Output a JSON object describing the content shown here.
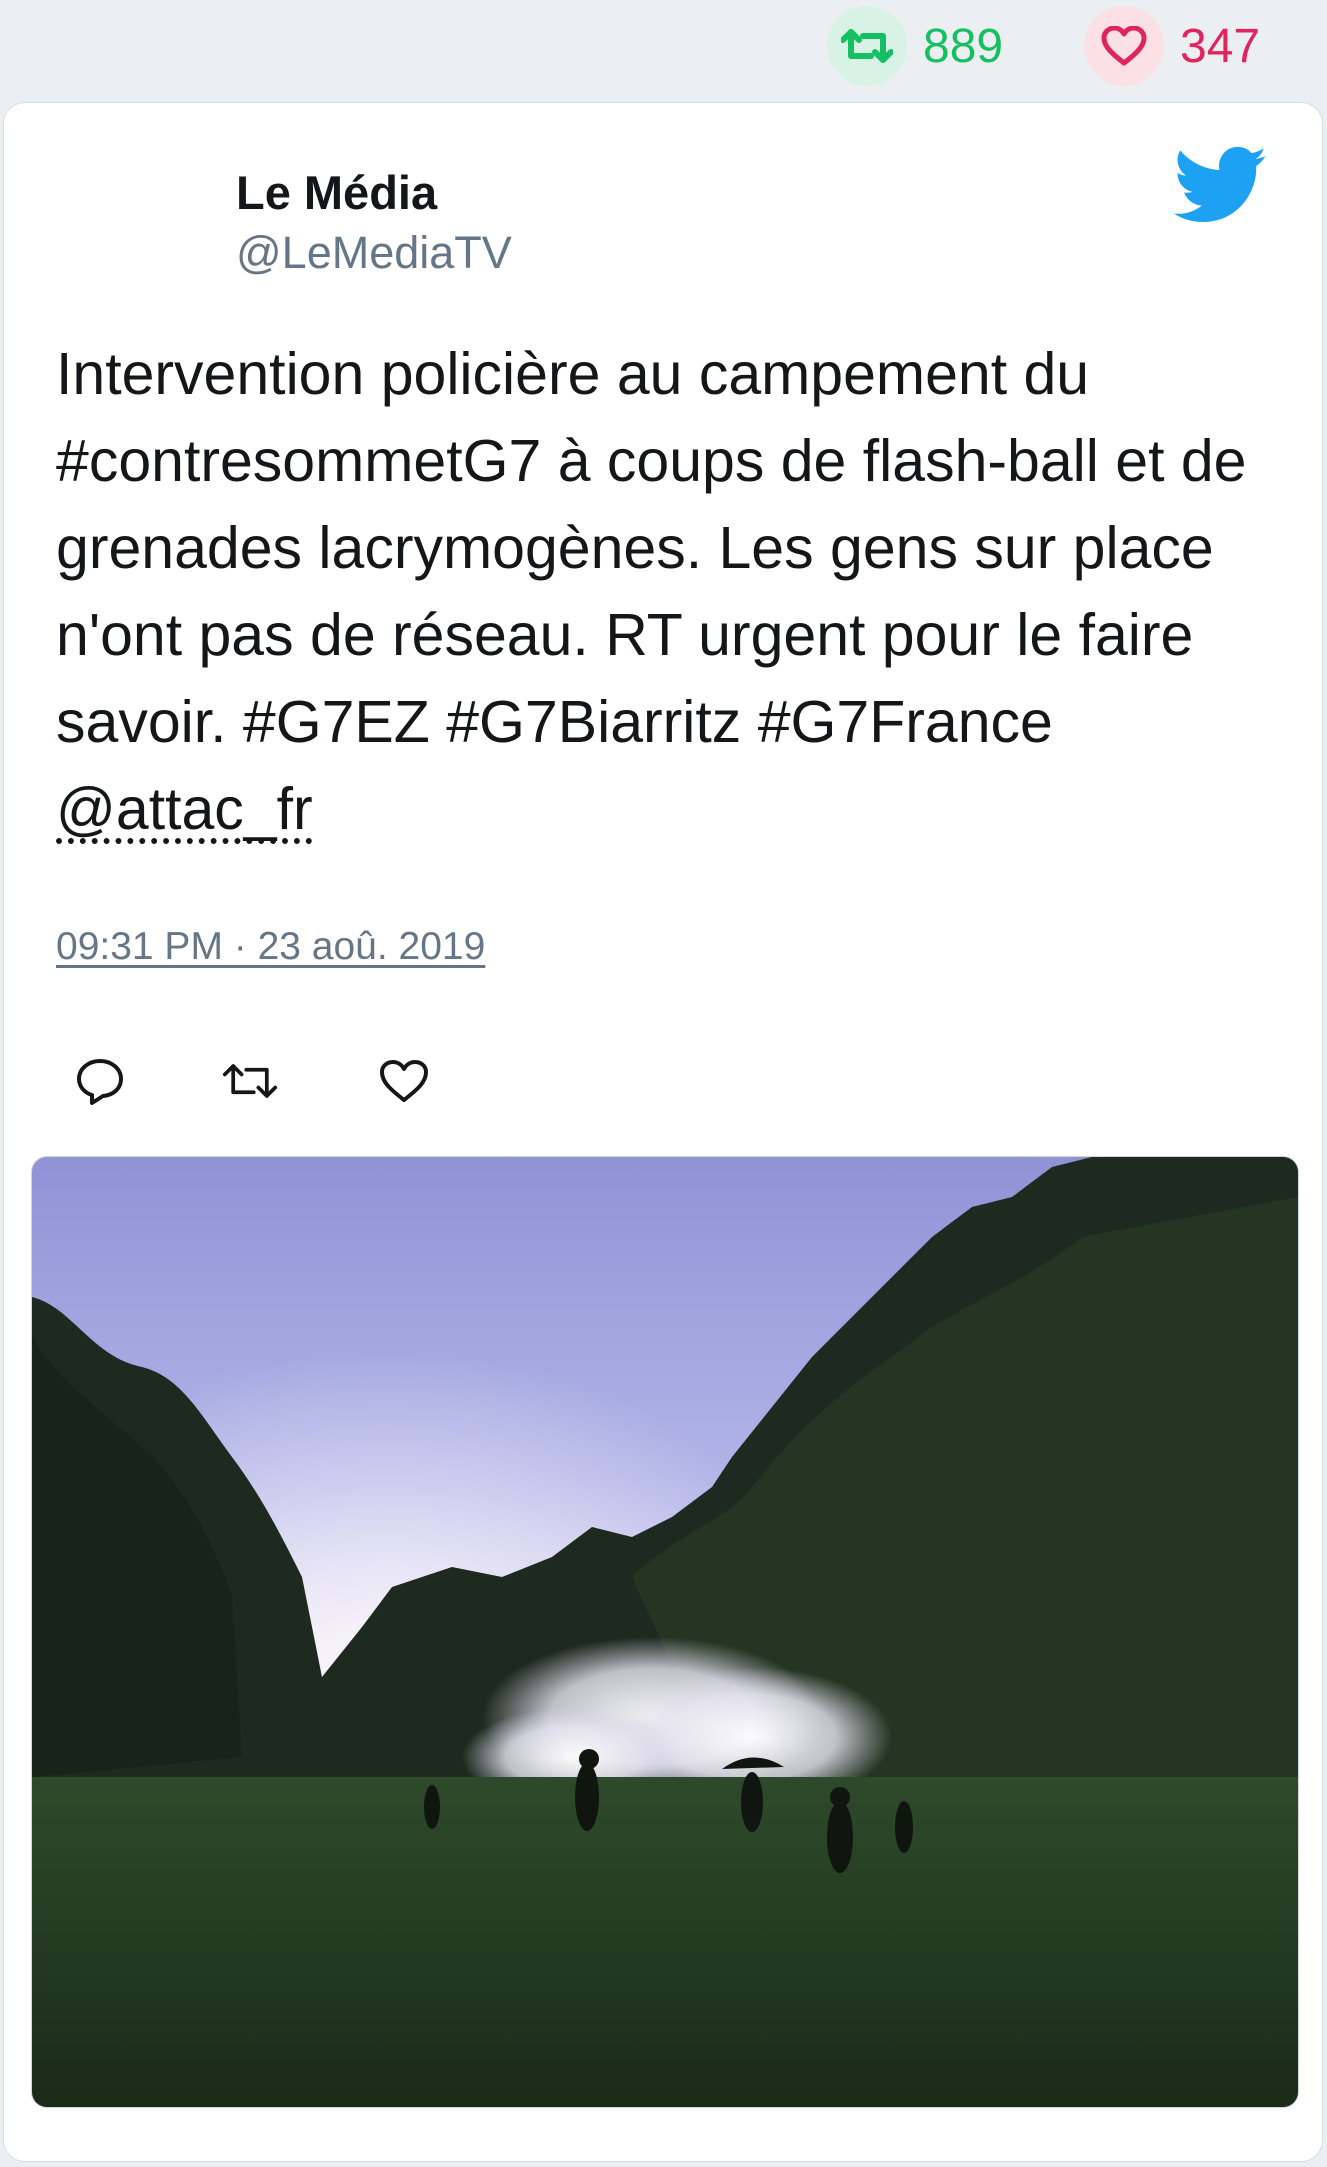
{
  "top_stats": {
    "retweet_icon": "retweet-icon",
    "retweet_count": "889",
    "like_icon": "heart-icon",
    "like_count": "347",
    "colors": {
      "retweet": "#17bf63",
      "like": "#e0245e"
    }
  },
  "tweet": {
    "author_name": "Le Média",
    "author_handle": "@LeMediaTV",
    "brand_icon": "twitter-bird-icon",
    "text_plain": "Intervention policière au campement du #contresommetG7 à coups de flash-ball et de grenades lacrymogènes. Les gens sur place n'ont pas de réseau. RT urgent pour le faire savoir. #G7EZ #G7Biarritz #G7France",
    "mention": "@attac_fr",
    "timestamp": "09:31 PM · 23 aoû. 2019",
    "actions": [
      {
        "name": "reply",
        "icon": "reply-icon"
      },
      {
        "name": "retweet",
        "icon": "retweet-icon"
      },
      {
        "name": "like",
        "icon": "heart-icon"
      }
    ],
    "media_image": "photo-tear-gas-field-at-dusk",
    "brand_color": "#1da1f2"
  }
}
